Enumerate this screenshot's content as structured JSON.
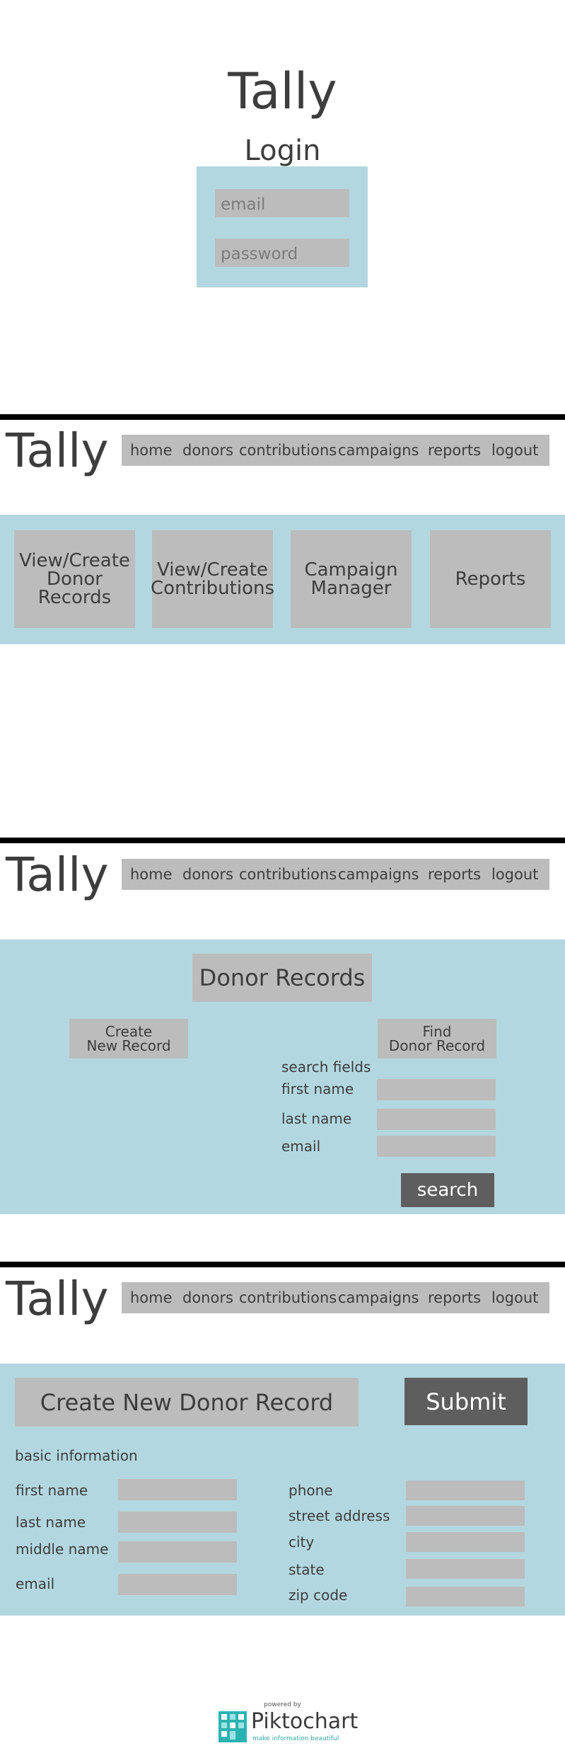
{
  "login": {
    "app_title": "Tally",
    "heading": "Login",
    "email_placeholder": "email",
    "password_placeholder": "password"
  },
  "nav": {
    "app_title": "Tally",
    "items": [
      "home",
      "donors",
      "contributions",
      "campaigns",
      "reports",
      "logout"
    ]
  },
  "dashboard": {
    "tiles": [
      {
        "line1": "View/Create",
        "line2": "Donor",
        "line3": "Records"
      },
      {
        "line1": "View/Create",
        "line2": "Contributions"
      },
      {
        "line1": "Campaign",
        "line2": "Manager"
      },
      {
        "line1": "Reports"
      }
    ]
  },
  "donor_records": {
    "heading": "Donor Records",
    "create_line1": "Create",
    "create_line2": "New Record",
    "find_line1": "Find",
    "find_line2": "Donor Record",
    "search_fields_label": "search fields",
    "first_name_label": "first name",
    "last_name_label": "last name",
    "email_label": "email",
    "search_button": "search"
  },
  "create_record": {
    "heading": "Create New Donor Record",
    "submit_button": "Submit",
    "section_label": "basic information",
    "left_labels": [
      "first name",
      "last name",
      "middle name",
      "email"
    ],
    "right_labels": [
      "phone",
      "street address",
      "city",
      "state",
      "zip code"
    ]
  },
  "footer": {
    "powered_by": "powered by",
    "brand": "Piktochart",
    "tagline": "make information beautiful"
  }
}
